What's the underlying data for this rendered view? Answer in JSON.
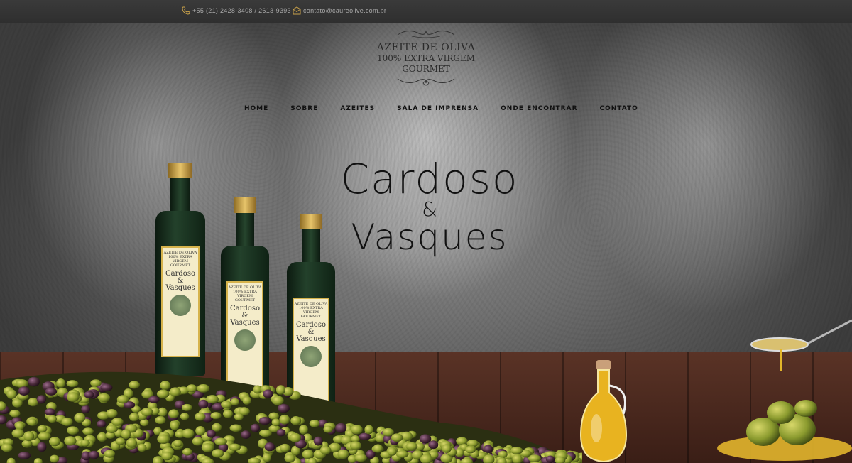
{
  "contact": {
    "phone": "+55 (21) 2428-3408 / 2613-9393",
    "email": "contato@caureolive.com.br"
  },
  "logo": {
    "line1": "AZEITE DE OLIVA",
    "line2": "100% EXTRA VIRGEM",
    "line3": "GOURMET"
  },
  "nav": {
    "items": [
      "HOME",
      "SOBRE",
      "AZEITES",
      "SALA DE IMPRENSA",
      "ONDE ENCONTRAR",
      "CONTATO"
    ]
  },
  "hero": {
    "title_line1": "Cardoso",
    "title_line2": "&",
    "title_line3": "Vasques"
  },
  "bottle_label": {
    "line1": "AZEITE DE OLIVA",
    "line2": "100% EXTRA VIRGEM",
    "line3": "GOURMET",
    "brand1": "Cardoso",
    "brand2": "&",
    "brand3": "Vasques"
  },
  "icons": {
    "phone": "phone-icon",
    "email": "email-icon"
  },
  "colors": {
    "topbar": "#333333",
    "contact_text": "#a9a9a9",
    "bottle_gold": "#d6b34c",
    "olive_green": "#8a9a2e"
  }
}
